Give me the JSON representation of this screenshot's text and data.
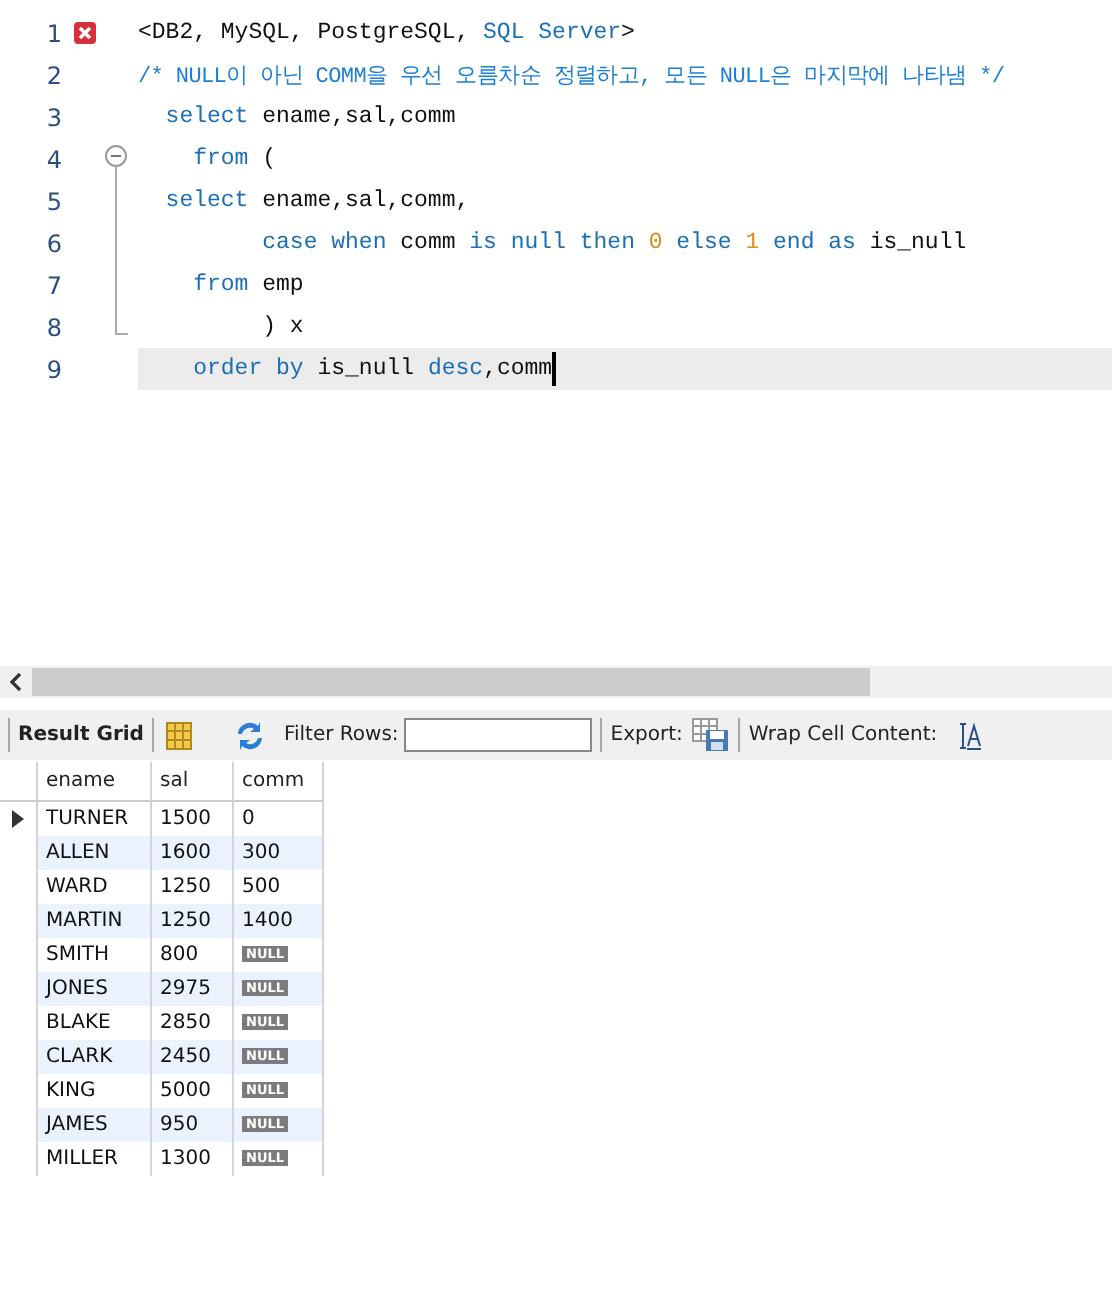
{
  "editor": {
    "lines": [
      {
        "number": "1",
        "error": true,
        "fold_toggle": false,
        "fold_guide": false,
        "current": false,
        "tokens": [
          {
            "kind": "plain",
            "text": "<DB2, MySQL, PostgreSQL, "
          },
          {
            "kind": "keyword",
            "text": "SQL Server"
          },
          {
            "kind": "plain",
            "text": ">"
          }
        ]
      },
      {
        "number": "2",
        "error": false,
        "fold_toggle": false,
        "fold_guide": false,
        "current": false,
        "tokens": [
          {
            "kind": "comment",
            "text": "/* NULL이 아닌 COMM을 우선 오름차순 정렬하고, 모든 NULL은 마지막에 나타냄 */"
          }
        ]
      },
      {
        "number": "3",
        "error": false,
        "fold_toggle": false,
        "fold_guide": false,
        "current": false,
        "tokens": [
          {
            "kind": "keyword",
            "text": "  select"
          },
          {
            "kind": "plain",
            "text": " ename,sal,comm"
          }
        ]
      },
      {
        "number": "4",
        "error": false,
        "fold_toggle": true,
        "fold_guide": false,
        "current": false,
        "tokens": [
          {
            "kind": "keyword",
            "text": "    from"
          },
          {
            "kind": "plain",
            "text": " ("
          }
        ]
      },
      {
        "number": "5",
        "error": false,
        "fold_toggle": false,
        "fold_guide": true,
        "current": false,
        "tokens": [
          {
            "kind": "keyword",
            "text": "  select"
          },
          {
            "kind": "plain",
            "text": " ename,sal,comm,"
          }
        ]
      },
      {
        "number": "6",
        "error": false,
        "fold_toggle": false,
        "fold_guide": true,
        "current": false,
        "tokens": [
          {
            "kind": "keyword",
            "text": "         case when"
          },
          {
            "kind": "plain",
            "text": " comm "
          },
          {
            "kind": "keyword",
            "text": "is null then "
          },
          {
            "kind": "number",
            "text": "0"
          },
          {
            "kind": "keyword",
            "text": " else "
          },
          {
            "kind": "number",
            "text": "1"
          },
          {
            "kind": "keyword",
            "text": " end as"
          },
          {
            "kind": "plain",
            "text": " is_null"
          }
        ]
      },
      {
        "number": "7",
        "error": false,
        "fold_toggle": false,
        "fold_guide": true,
        "current": false,
        "tokens": [
          {
            "kind": "keyword",
            "text": "    from"
          },
          {
            "kind": "plain",
            "text": " emp"
          }
        ]
      },
      {
        "number": "8",
        "error": false,
        "fold_toggle": false,
        "fold_guide": true,
        "current": false,
        "tokens": [
          {
            "kind": "plain",
            "text": "         ) x"
          }
        ]
      },
      {
        "number": "9",
        "error": false,
        "fold_toggle": false,
        "fold_guide": false,
        "current": true,
        "tokens": [
          {
            "kind": "keyword",
            "text": "    order by"
          },
          {
            "kind": "plain",
            "text": " is_null "
          },
          {
            "kind": "keyword",
            "text": "desc"
          },
          {
            "kind": "plain",
            "text": ",comm"
          }
        ]
      }
    ]
  },
  "toolbar": {
    "result_tab": "Result Grid",
    "filter_label": "Filter Rows:",
    "export_label": "Export:",
    "wrap_label": "Wrap Cell Content:"
  },
  "grid": {
    "columns": [
      "ename",
      "sal",
      "comm"
    ],
    "rows": [
      {
        "selected": true,
        "cells": [
          {
            "kind": "value",
            "text": "TURNER"
          },
          {
            "kind": "value",
            "text": "1500"
          },
          {
            "kind": "value",
            "text": "0"
          }
        ]
      },
      {
        "selected": false,
        "cells": [
          {
            "kind": "value",
            "text": "ALLEN"
          },
          {
            "kind": "value",
            "text": "1600"
          },
          {
            "kind": "value",
            "text": "300"
          }
        ]
      },
      {
        "selected": false,
        "cells": [
          {
            "kind": "value",
            "text": "WARD"
          },
          {
            "kind": "value",
            "text": "1250"
          },
          {
            "kind": "value",
            "text": "500"
          }
        ]
      },
      {
        "selected": false,
        "cells": [
          {
            "kind": "value",
            "text": "MARTIN"
          },
          {
            "kind": "value",
            "text": "1250"
          },
          {
            "kind": "value",
            "text": "1400"
          }
        ]
      },
      {
        "selected": false,
        "cells": [
          {
            "kind": "value",
            "text": "SMITH"
          },
          {
            "kind": "value",
            "text": "800"
          },
          {
            "kind": "null",
            "text": "NULL"
          }
        ]
      },
      {
        "selected": false,
        "cells": [
          {
            "kind": "value",
            "text": "JONES"
          },
          {
            "kind": "value",
            "text": "2975"
          },
          {
            "kind": "null",
            "text": "NULL"
          }
        ]
      },
      {
        "selected": false,
        "cells": [
          {
            "kind": "value",
            "text": "BLAKE"
          },
          {
            "kind": "value",
            "text": "2850"
          },
          {
            "kind": "null",
            "text": "NULL"
          }
        ]
      },
      {
        "selected": false,
        "cells": [
          {
            "kind": "value",
            "text": "CLARK"
          },
          {
            "kind": "value",
            "text": "2450"
          },
          {
            "kind": "null",
            "text": "NULL"
          }
        ]
      },
      {
        "selected": false,
        "cells": [
          {
            "kind": "value",
            "text": "KING"
          },
          {
            "kind": "value",
            "text": "5000"
          },
          {
            "kind": "null",
            "text": "NULL"
          }
        ]
      },
      {
        "selected": false,
        "cells": [
          {
            "kind": "value",
            "text": "JAMES"
          },
          {
            "kind": "value",
            "text": "950"
          },
          {
            "kind": "null",
            "text": "NULL"
          }
        ]
      },
      {
        "selected": false,
        "cells": [
          {
            "kind": "value",
            "text": "MILLER"
          },
          {
            "kind": "value",
            "text": "1300"
          },
          {
            "kind": "null",
            "text": "NULL"
          }
        ]
      }
    ]
  }
}
